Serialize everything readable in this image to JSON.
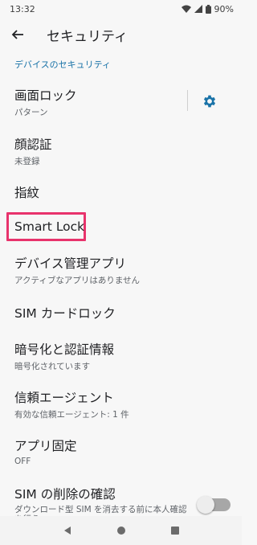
{
  "status_bar": {
    "time": "13:32",
    "battery": "90%",
    "icons": [
      "wifi-icon",
      "signal-icon",
      "battery-icon"
    ]
  },
  "app_bar": {
    "title": "セキュリティ",
    "back_icon": "arrow-left-icon"
  },
  "section": {
    "header": "デバイスのセキュリティ"
  },
  "items": [
    {
      "title": "画面ロック",
      "subtitle": "パターン"
    },
    {
      "title": "顔認証",
      "subtitle": "未登録"
    },
    {
      "title": "指紋",
      "subtitle": ""
    },
    {
      "title": "Smart Lock",
      "subtitle": ""
    },
    {
      "title": "デバイス管理アプリ",
      "subtitle": "アクティブなアプリはありません"
    },
    {
      "title": "SIM カードロック",
      "subtitle": ""
    },
    {
      "title": "暗号化と認証情報",
      "subtitle": "暗号化されています"
    },
    {
      "title": "信頼エージェント",
      "subtitle": "有効な信頼エージェント: 1 件"
    },
    {
      "title": "アプリ固定",
      "subtitle": "OFF"
    },
    {
      "title": "SIM の削除の確認",
      "subtitle": "ダウンロード型 SIM を消去する前に本人確認を行う"
    }
  ],
  "sim_delete_toggle": {
    "state": "off"
  },
  "colors": {
    "accent": "#1a73a8",
    "highlight": "#e8336c",
    "background": "#f7f7f7"
  },
  "nav_bar": {
    "buttons": [
      "back-triangle-icon",
      "home-circle-icon",
      "recents-square-icon"
    ]
  }
}
